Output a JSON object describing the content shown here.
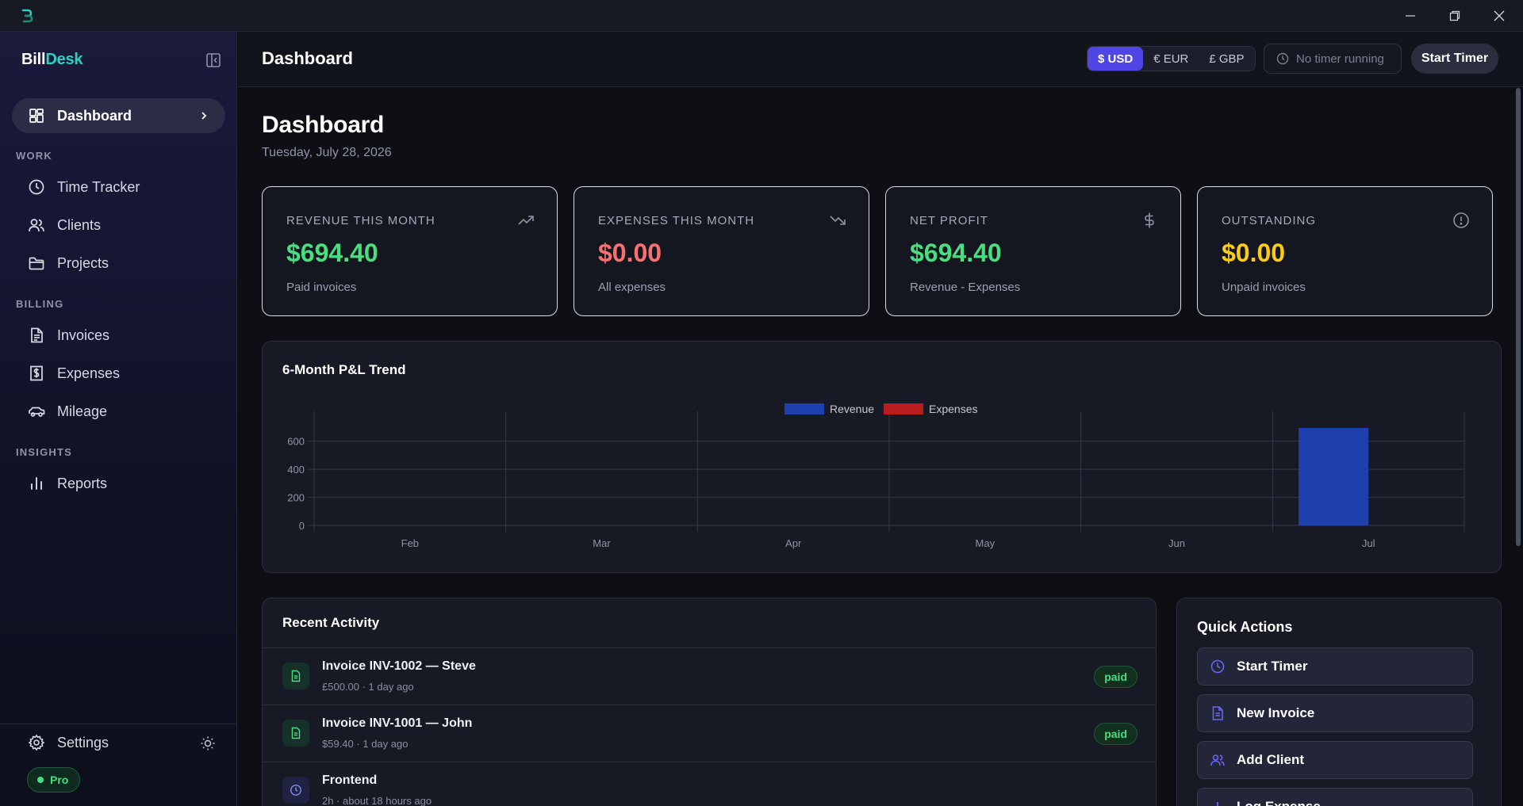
{
  "app": {
    "brand_part1": "Bill",
    "brand_part2": "Desk"
  },
  "sidebar": {
    "items": {
      "dashboard": "Dashboard",
      "time_tracker": "Time Tracker",
      "clients": "Clients",
      "projects": "Projects",
      "invoices": "Invoices",
      "expenses": "Expenses",
      "mileage": "Mileage",
      "reports": "Reports",
      "settings": "Settings"
    },
    "sections": {
      "work": "WORK",
      "billing": "BILLING",
      "insights": "INSIGHTS"
    },
    "plan_badge": "Pro"
  },
  "topbar": {
    "title": "Dashboard",
    "currencies": [
      "$ USD",
      "€ EUR",
      "£ GBP"
    ],
    "selected_currency": "$ USD",
    "timer_status": "No timer running",
    "start_timer": "Start Timer"
  },
  "page": {
    "title": "Dashboard",
    "date": "Tuesday, July 28, 2026"
  },
  "stats": {
    "revenue": {
      "label": "REVENUE THIS MONTH",
      "value": "$694.40",
      "sub": "Paid invoices",
      "color": "#4ade80",
      "icon": "trending-up-icon"
    },
    "expenses": {
      "label": "EXPENSES THIS MONTH",
      "value": "$0.00",
      "sub": "All expenses",
      "color": "#f87171",
      "icon": "trending-down-icon"
    },
    "profit": {
      "label": "NET PROFIT",
      "value": "$694.40",
      "sub": "Revenue - Expenses",
      "color": "#4ade80",
      "icon": "dollar-icon"
    },
    "outstanding": {
      "label": "OUTSTANDING",
      "value": "$0.00",
      "sub": "Unpaid invoices",
      "color": "#facc15",
      "icon": "alert-circle-icon"
    }
  },
  "chart": {
    "title": "6-Month P&L Trend"
  },
  "chart_data": {
    "type": "bar",
    "categories": [
      "Feb",
      "Mar",
      "Apr",
      "May",
      "Jun",
      "Jul"
    ],
    "series": [
      {
        "name": "Revenue",
        "values": [
          0,
          0,
          0,
          0,
          0,
          694.4
        ],
        "color": "#1e40af"
      },
      {
        "name": "Expenses",
        "values": [
          0,
          0,
          0,
          0,
          0,
          0
        ],
        "color": "#b91c1c"
      }
    ],
    "yticks": [
      "0",
      "200",
      "400",
      "600"
    ],
    "ylim": [
      0,
      700
    ],
    "legend": "top-center",
    "grid": true
  },
  "activity": {
    "title": "Recent Activity",
    "items": [
      {
        "title": "Invoice INV-1002 — Steve",
        "sub": "£500.00 · 1 day ago",
        "badge": "paid",
        "icon": "document-icon"
      },
      {
        "title": "Invoice INV-1001 — John",
        "sub": "$59.40 · 1 day ago",
        "badge": "paid",
        "icon": "document-icon"
      },
      {
        "title": "Frontend",
        "sub": "2h · about 18 hours ago",
        "badge": "",
        "icon": "clock-icon"
      }
    ]
  },
  "quick_actions": {
    "title": "Quick Actions",
    "items": [
      "Start Timer",
      "New Invoice",
      "Add Client",
      "Log Expense"
    ]
  },
  "colors": {
    "accent": "#4f46e5",
    "brand_teal": "#2bd4c0",
    "success": "#4ade80",
    "danger": "#f87171",
    "warning": "#facc15"
  }
}
